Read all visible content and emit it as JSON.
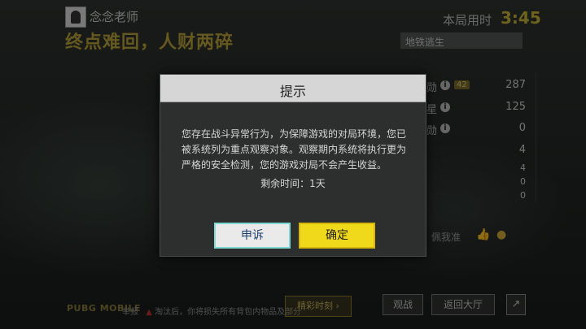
{
  "player": {
    "name": "念念老师",
    "headline": "终点难回，人财两碎"
  },
  "match": {
    "time_label": "本局用时",
    "time_value": "3:45",
    "rank_text": "地铁逃生"
  },
  "stats": [
    {
      "label": "勋",
      "value": "287"
    },
    {
      "label": "星",
      "value": "125"
    },
    {
      "label": "勋",
      "value": "0"
    },
    {
      "value": "4"
    },
    {
      "value": "4"
    },
    {
      "value": "0"
    },
    {
      "value": "0"
    }
  ],
  "badge": "42",
  "like_text": "佩我准",
  "dialog": {
    "title": "提示",
    "message": "您存在战斗异常行为，为保障游戏的对局环境，您已被系统列为重点观察对象。观察期内系统将执行更为严格的安全检测，您的游戏对局不会产生收益。",
    "remaining": "剩余时间：1天",
    "appeal_label": "申诉",
    "confirm_label": "确定"
  },
  "bottom": {
    "logo": "PUBG MOBILE",
    "report": "举报",
    "notice": "淘汰后，你将损失所有背包内物品及部分",
    "highlight_label": "精彩时刻",
    "spectate_label": "观战",
    "lobby_label": "返回大厅"
  },
  "colors": {
    "accent": "#f0d81a",
    "headline": "#b9a23a",
    "appeal_border": "#7fd9d2"
  }
}
